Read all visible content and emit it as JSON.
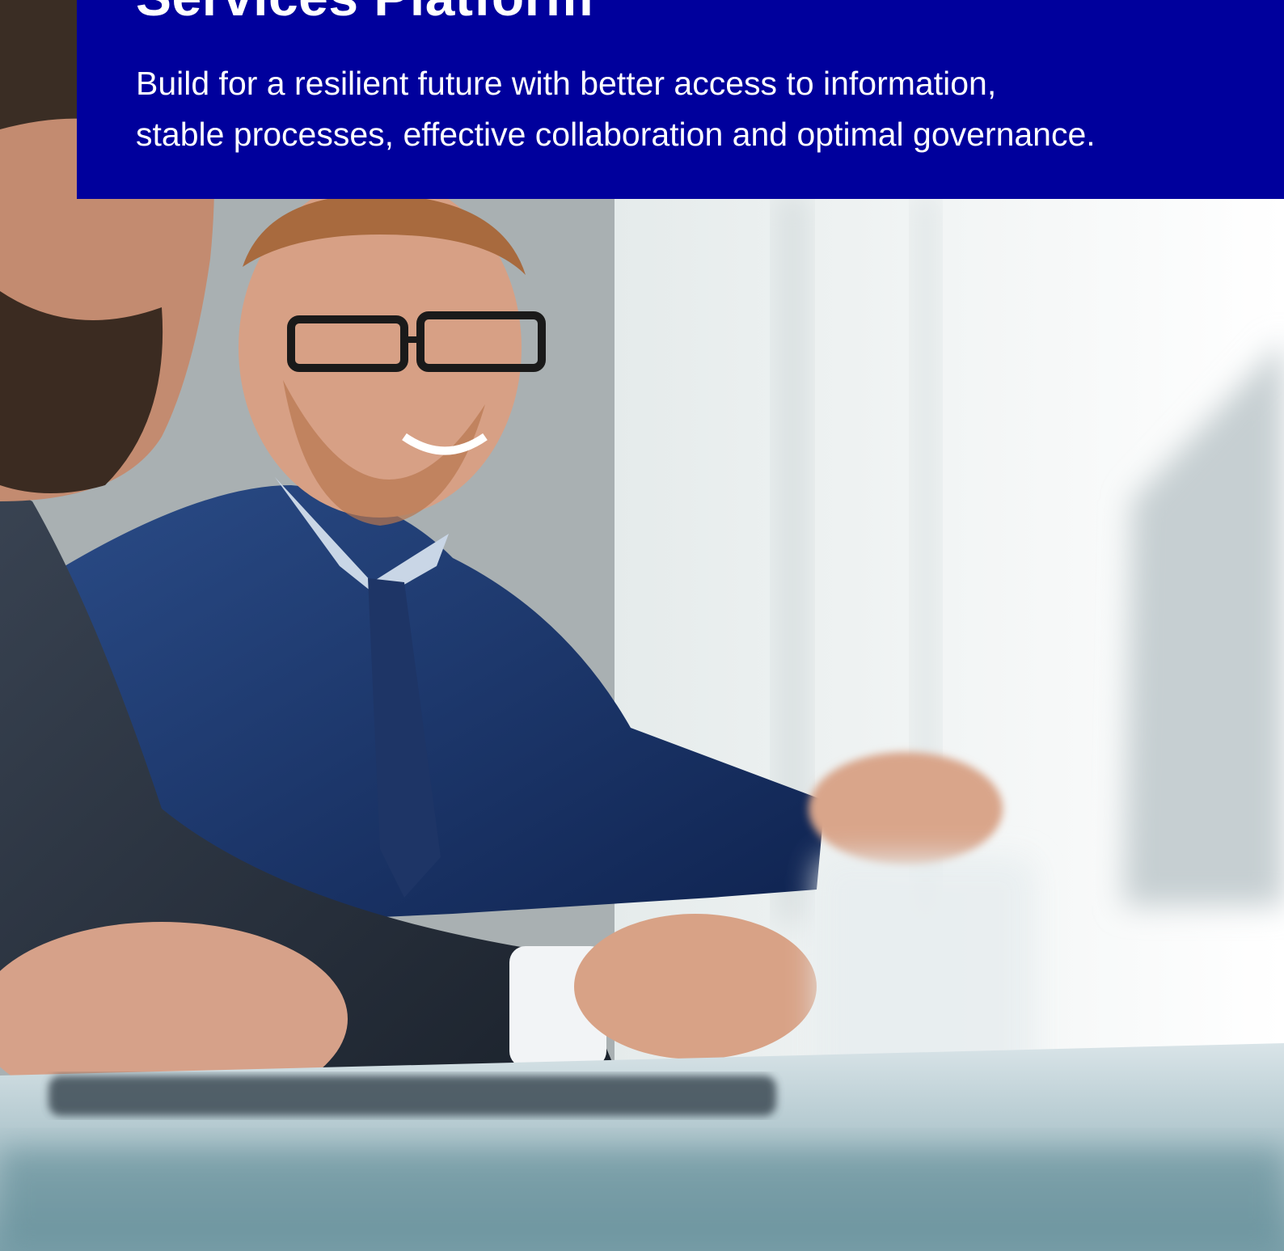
{
  "hero": {
    "title": "Services Platform",
    "subtitle_line1": "Build for a resilient future with better access to information,",
    "subtitle_line2": "stable processes, effective collaboration and optimal governance."
  },
  "colors": {
    "banner_bg": "#00009c",
    "banner_text": "#ffffff"
  }
}
